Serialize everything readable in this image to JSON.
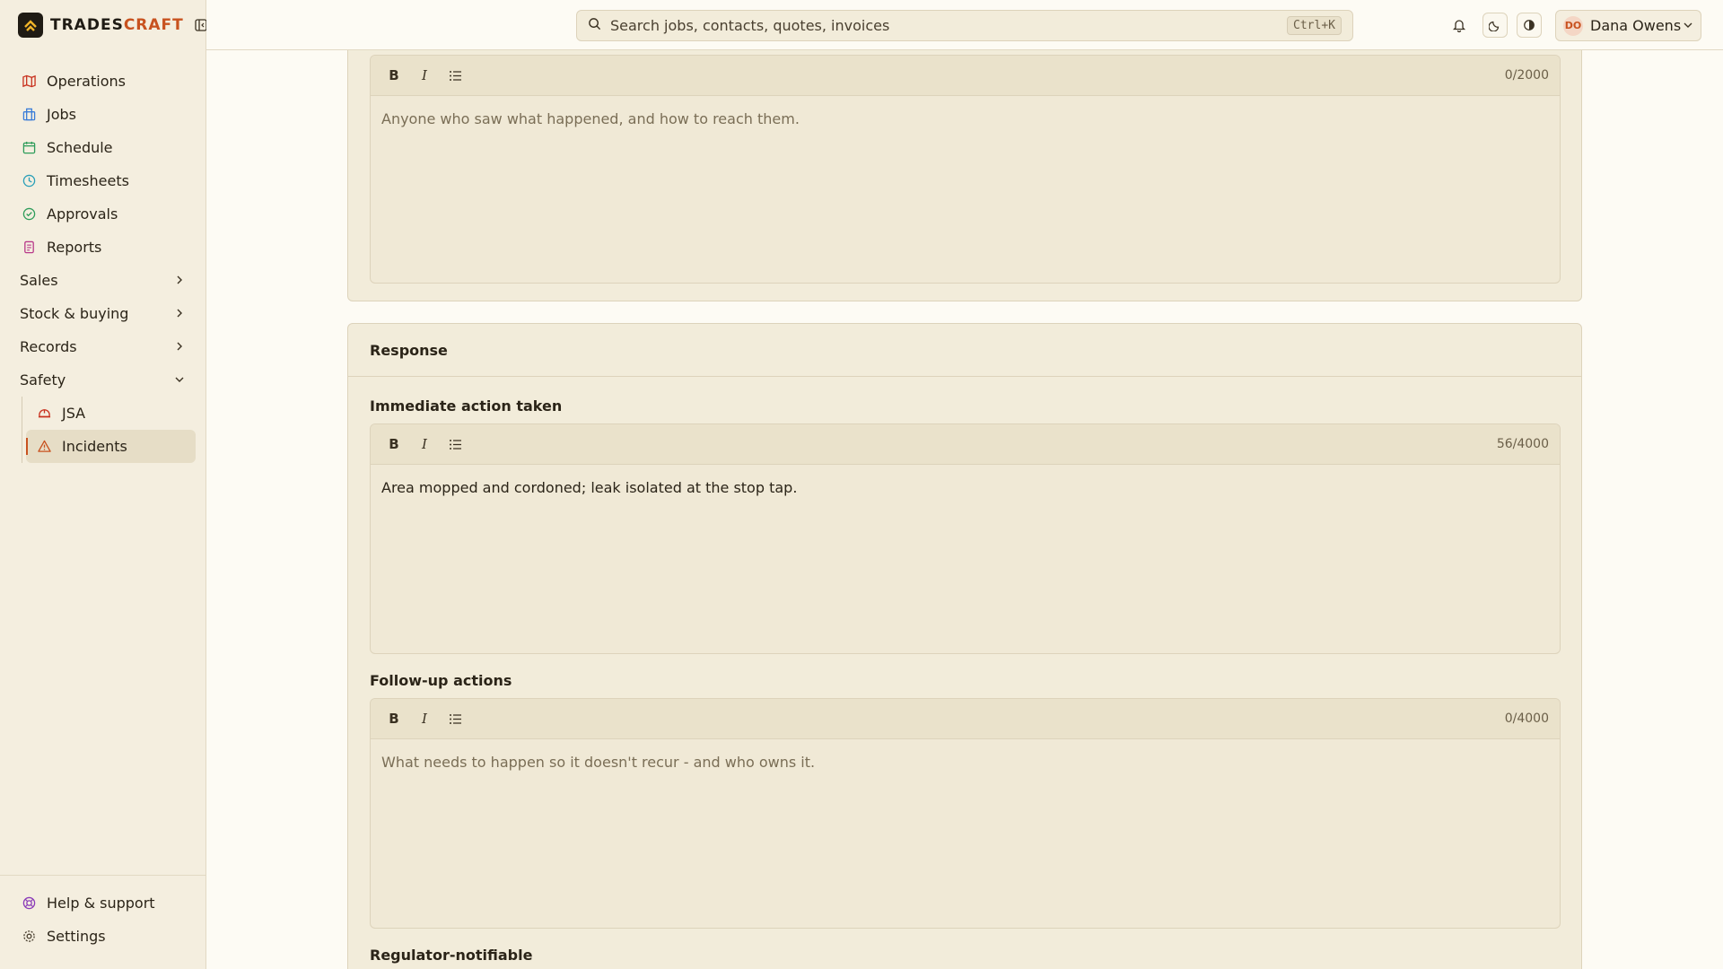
{
  "brand": {
    "name_main": "TRADES",
    "name_accent": "CRAFT"
  },
  "nav": {
    "items": [
      {
        "label": "Operations"
      },
      {
        "label": "Jobs"
      },
      {
        "label": "Schedule"
      },
      {
        "label": "Timesheets"
      },
      {
        "label": "Approvals"
      },
      {
        "label": "Reports"
      }
    ],
    "groups": [
      {
        "label": "Sales"
      },
      {
        "label": "Stock & buying"
      },
      {
        "label": "Records"
      },
      {
        "label": "Safety"
      }
    ],
    "safety_items": [
      {
        "label": "JSA"
      },
      {
        "label": "Incidents"
      }
    ],
    "bottom": [
      {
        "label": "Help & support"
      },
      {
        "label": "Settings"
      }
    ]
  },
  "topbar": {
    "search_placeholder": "Search jobs, contacts, quotes, invoices",
    "search_shortcut": "Ctrl+K",
    "user_initials": "DO",
    "user_name": "Dana Owens"
  },
  "witnesses_card": {
    "counter": "0/2000",
    "placeholder": "Anyone who saw what happened, and how to reach them."
  },
  "response_card": {
    "title": "Response",
    "immediate": {
      "label": "Immediate action taken",
      "counter": "56/4000",
      "value": "Area mopped and cordoned; leak isolated at the stop tap."
    },
    "followup": {
      "label": "Follow-up actions",
      "counter": "0/4000",
      "placeholder": "What needs to happen so it doesn't recur - and who owns it."
    },
    "regulator_label": "Regulator-notifiable"
  },
  "colors": {
    "accent": "#c8521f",
    "background": "#fdfbf4",
    "sidebar": "#f4eedf",
    "card": "#f2ecda"
  }
}
